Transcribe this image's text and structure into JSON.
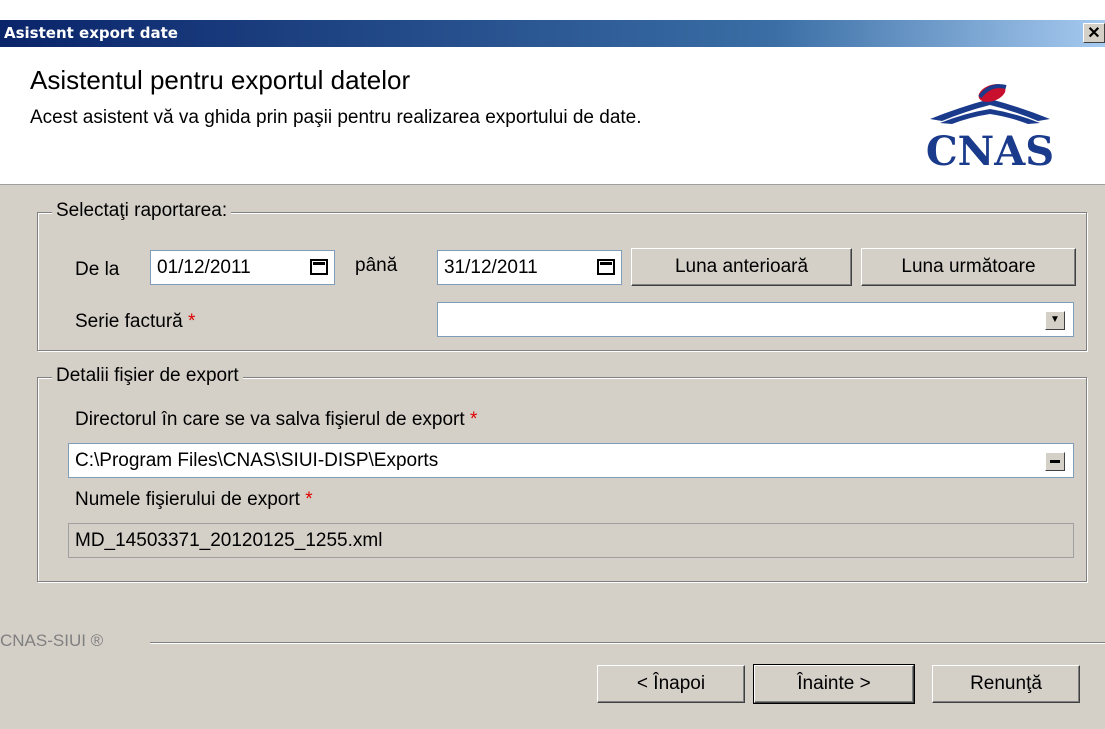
{
  "window": {
    "title": "Asistent export date",
    "close_glyph": "✕"
  },
  "header": {
    "title": "Asistentul pentru exportul datelor",
    "subtitle": "Acest asistent vă va ghida prin paşii pentru realizarea exportului de date.",
    "logo_text": "CNAS"
  },
  "report_group": {
    "legend": "Selectaţi raportarea:",
    "from_label": "De la",
    "from_value": "01/12/2011",
    "to_label": "până",
    "to_value": "31/12/2011",
    "prev_month_label": "Luna anterioară",
    "next_month_label": "Luna următoare",
    "series_label": "Serie factură",
    "series_value": "",
    "required_mark": "*"
  },
  "export_group": {
    "legend": "Detalii fişier de export",
    "dir_label": "Directorul în care se va salva fişierul de export",
    "dir_value": "C:\\Program Files\\CNAS\\SIUI-DISP\\Exports",
    "file_label": "Numele fişierului de export",
    "file_value": "MD_14503371_20120125_1255.xml",
    "required_mark": "*"
  },
  "footer": {
    "brand": "CNAS-SIUI ®",
    "back_label": "< Înapoi",
    "next_label": "Înainte >",
    "cancel_label": "Renunţă"
  },
  "colors": {
    "title_start": "#0a246a",
    "title_end": "#a6caf0",
    "dialog_bg": "#d4d0c8",
    "required": "#e00000",
    "logo_blue": "#1a3a8c",
    "logo_red": "#c8102e"
  }
}
